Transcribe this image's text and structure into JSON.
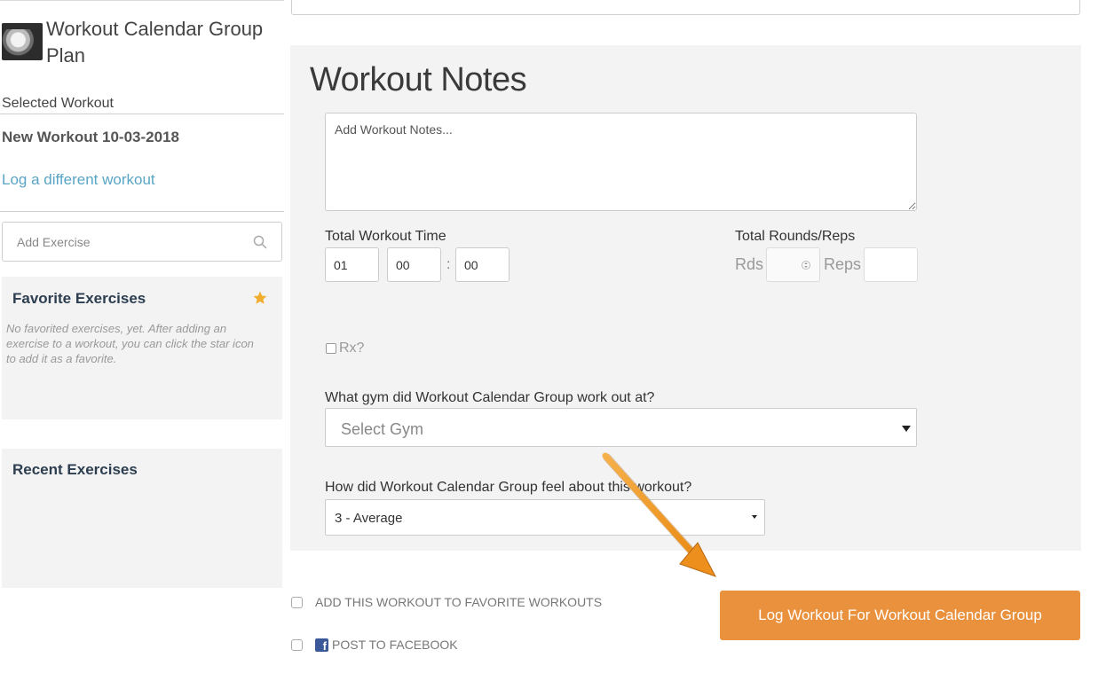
{
  "sidebar": {
    "plan_title": "Workout Calendar Group Plan",
    "selected_label": "Selected Workout",
    "selected_workout": "New Workout 10-03-2018",
    "log_different_link": "Log a different workout",
    "add_exercise_placeholder": "Add Exercise",
    "favorites": {
      "title": "Favorite Exercises",
      "empty_text": "No favorited exercises, yet. After adding an exercise to a workout, you can click the star icon to add it as a favorite.",
      "icon": "star-icon"
    },
    "recent": {
      "title": "Recent Exercises"
    }
  },
  "main": {
    "notes_heading": "Workout Notes",
    "notes_placeholder": "Add Workout Notes...",
    "total_time_label": "Total Workout Time",
    "time": {
      "hours": "01",
      "minutes": "00",
      "seconds": "00",
      "separator": ":"
    },
    "rounds_label": "Total Rounds/Reps",
    "rds_label": "Rds",
    "reps_label": "Reps",
    "rx_label": "Rx?",
    "gym_question": "What gym did Workout Calendar Group work out at?",
    "gym_select_value": "Select Gym",
    "feel_question": "How did Workout Calendar Group feel about this workout?",
    "feel_select_value": "3 - Average"
  },
  "actions": {
    "favorite_option": "ADD THIS WORKOUT TO FAVORITE WORKOUTS",
    "facebook_option": "POST TO FACEBOOK",
    "log_button": "Log Workout For Workout Calendar Group"
  },
  "colors": {
    "accent_orange": "#e9913c",
    "link_blue": "#5aa5c5",
    "star_gold": "#f0ad2e",
    "facebook_blue": "#3b5998",
    "panel_gray": "#f3f3f3"
  }
}
